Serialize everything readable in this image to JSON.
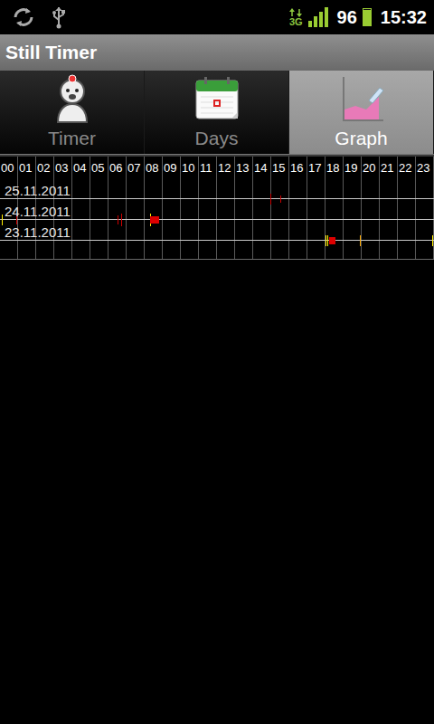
{
  "status_bar": {
    "network": "3G",
    "signal_level": 1,
    "battery": "96",
    "battery_level": 0.96,
    "time": "15:32"
  },
  "window": {
    "title": "Still Timer"
  },
  "tabs": [
    {
      "label": "Timer",
      "selected": false
    },
    {
      "label": "Days",
      "selected": false
    },
    {
      "label": "Graph",
      "selected": true
    }
  ],
  "chart": {
    "hours": [
      "00",
      "01",
      "02",
      "03",
      "04",
      "05",
      "06",
      "07",
      "08",
      "09",
      "10",
      "11",
      "12",
      "13",
      "14",
      "15",
      "16",
      "17",
      "18",
      "19",
      "20",
      "21",
      "22",
      "23"
    ],
    "rows": [
      {
        "date": "25.11.2011",
        "marks": [
          {
            "start": 14.95,
            "end": 15.0,
            "level": 0.6,
            "color": "#cc0000"
          },
          {
            "start": 15.5,
            "end": 15.55,
            "level": 0.4,
            "color": "#cc0000"
          }
        ]
      },
      {
        "date": "24.11.2011",
        "marks": [
          {
            "start": 0.1,
            "end": 0.15,
            "level": 0.6,
            "color": "#ffee00"
          },
          {
            "start": 0.9,
            "end": 0.95,
            "level": 0.5,
            "color": "#cc0000"
          },
          {
            "start": 6.5,
            "end": 6.55,
            "level": 0.5,
            "color": "#cc0000"
          },
          {
            "start": 6.7,
            "end": 6.75,
            "level": 0.7,
            "color": "#cc0000"
          },
          {
            "start": 8.3,
            "end": 8.35,
            "level": 0.7,
            "color": "#ffee00"
          },
          {
            "start": 8.3,
            "end": 8.8,
            "level": 0.4,
            "color": "#dd0000"
          }
        ]
      },
      {
        "date": "23.11.2011",
        "marks": [
          {
            "start": 18.0,
            "end": 18.05,
            "level": 0.6,
            "color": "#ffee00"
          },
          {
            "start": 18.1,
            "end": 18.15,
            "level": 0.6,
            "color": "#ffee00"
          },
          {
            "start": 18.2,
            "end": 18.55,
            "level": 0.4,
            "color": "#dd0000"
          },
          {
            "start": 19.9,
            "end": 19.95,
            "level": 0.6,
            "color": "#ffaa00"
          },
          {
            "start": 23.9,
            "end": 23.95,
            "level": 0.6,
            "color": "#ffee00"
          }
        ]
      }
    ]
  }
}
